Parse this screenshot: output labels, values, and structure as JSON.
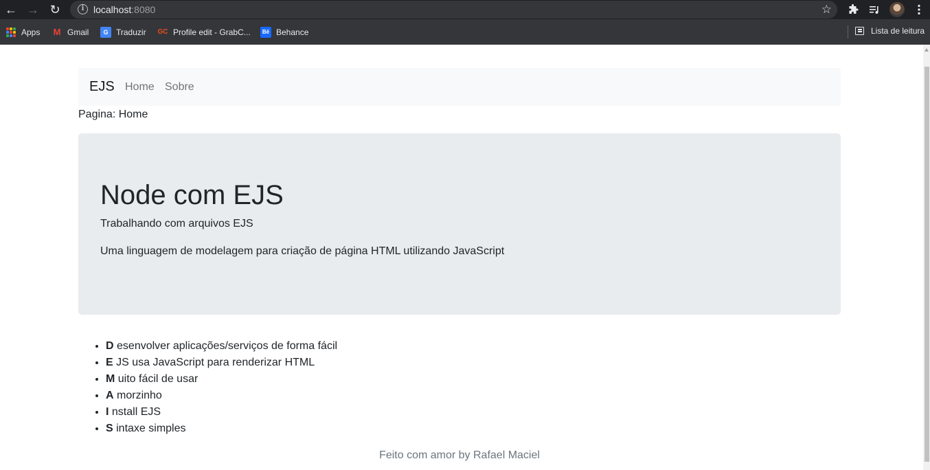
{
  "browser": {
    "url_host": "localhost",
    "url_port": ":8080",
    "bookmarks": [
      {
        "label": "Apps",
        "icon": "apps-grid-icon"
      },
      {
        "label": "Gmail",
        "icon": "gmail-icon"
      },
      {
        "label": "Traduzir",
        "icon": "translate-icon"
      },
      {
        "label": "Profile edit - GrabC...",
        "icon": "grabcad-icon"
      },
      {
        "label": "Behance",
        "icon": "behance-icon"
      }
    ],
    "reading_list": "Lista de leitura"
  },
  "navbar": {
    "brand": "EJS",
    "links": [
      "Home",
      "Sobre"
    ]
  },
  "page_label": "Pagina: Home",
  "jumbotron": {
    "title": "Node com EJS",
    "subtitle": "Trabalhando com arquivos EJS",
    "description": "Uma linguagem de modelagem para criação de página HTML utilizando JavaScript"
  },
  "features": [
    {
      "letter": "D",
      "rest": "esenvolver aplicações/serviços de forma fácil"
    },
    {
      "letter": "E",
      "rest": "JS usa JavaScript para renderizar HTML"
    },
    {
      "letter": "M",
      "rest": "uito fácil de usar"
    },
    {
      "letter": "A",
      "rest": "morzinho"
    },
    {
      "letter": "I",
      "rest": "nstall EJS"
    },
    {
      "letter": "S",
      "rest": "intaxe simples"
    }
  ],
  "footer": "Feito com amor by Rafael Maciel",
  "colors": {
    "chrome_dark": "#202124",
    "toolbar": "#35363a",
    "navbar_bg": "#f8f9fa",
    "jumbotron_bg": "#e9ecef",
    "text": "#212529",
    "muted": "#6c757d"
  }
}
